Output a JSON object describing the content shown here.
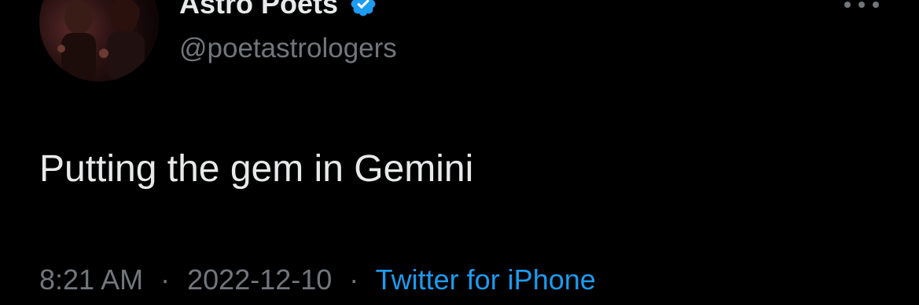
{
  "tweet": {
    "author": {
      "display_name": "Astro Poets",
      "handle": "@poetastrologers",
      "verified": true,
      "avatar_icon": "profile-photo"
    },
    "more_icon": "more-horizontal-icon",
    "text": "Putting the gem in Gemini",
    "time": "8:21 AM",
    "separator": "·",
    "date": "2022-12-10",
    "source": "Twitter for iPhone"
  },
  "colors": {
    "background": "#000000",
    "primary_text": "#e7e9ea",
    "secondary_text": "#71767b",
    "accent": "#1d9bf0"
  }
}
